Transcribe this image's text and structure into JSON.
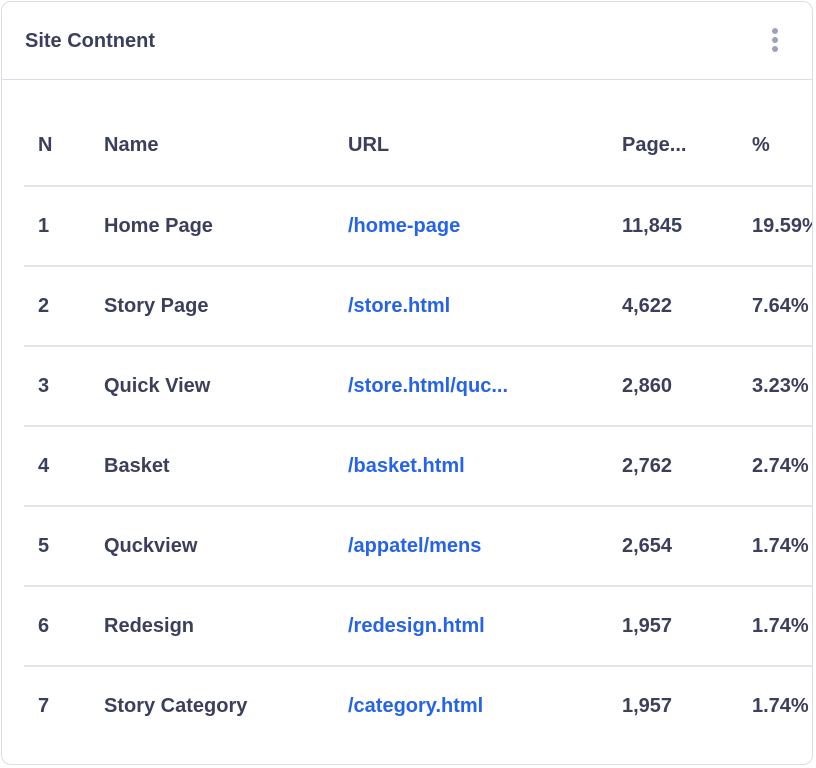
{
  "card": {
    "title": "Site Contnent",
    "menu_icon": "more-vertical-icon"
  },
  "colors": {
    "text": "#3a3f5c",
    "link": "#2563eb",
    "border": "#dcdde6",
    "menu_dots": "#9ea2b8"
  },
  "table": {
    "headers": {
      "n": "N",
      "name": "Name",
      "url": "URL",
      "views": "Page...",
      "pct": "%"
    },
    "rows": [
      {
        "n": "1",
        "name": "Home Page",
        "url": "/home-page",
        "views": "11,845",
        "pct": "19.59%"
      },
      {
        "n": "2",
        "name": "Story Page",
        "url": "/store.html",
        "views": "4,622",
        "pct": "7.64%"
      },
      {
        "n": "3",
        "name": "Quick View",
        "url": "/store.html/quc...",
        "views": "2,860",
        "pct": "3.23%"
      },
      {
        "n": "4",
        "name": "Basket",
        "url": "/basket.html",
        "views": "2,762",
        "pct": "2.74%"
      },
      {
        "n": "5",
        "name": "Quckview",
        "url": "/appatel/mens",
        "views": "2,654",
        "pct": "1.74%"
      },
      {
        "n": "6",
        "name": "Redesign",
        "url": "/redesign.html",
        "views": "1,957",
        "pct": "1.74%"
      },
      {
        "n": "7",
        "name": "Story Category",
        "url": "/category.html",
        "views": "1,957",
        "pct": "1.74%"
      }
    ]
  }
}
